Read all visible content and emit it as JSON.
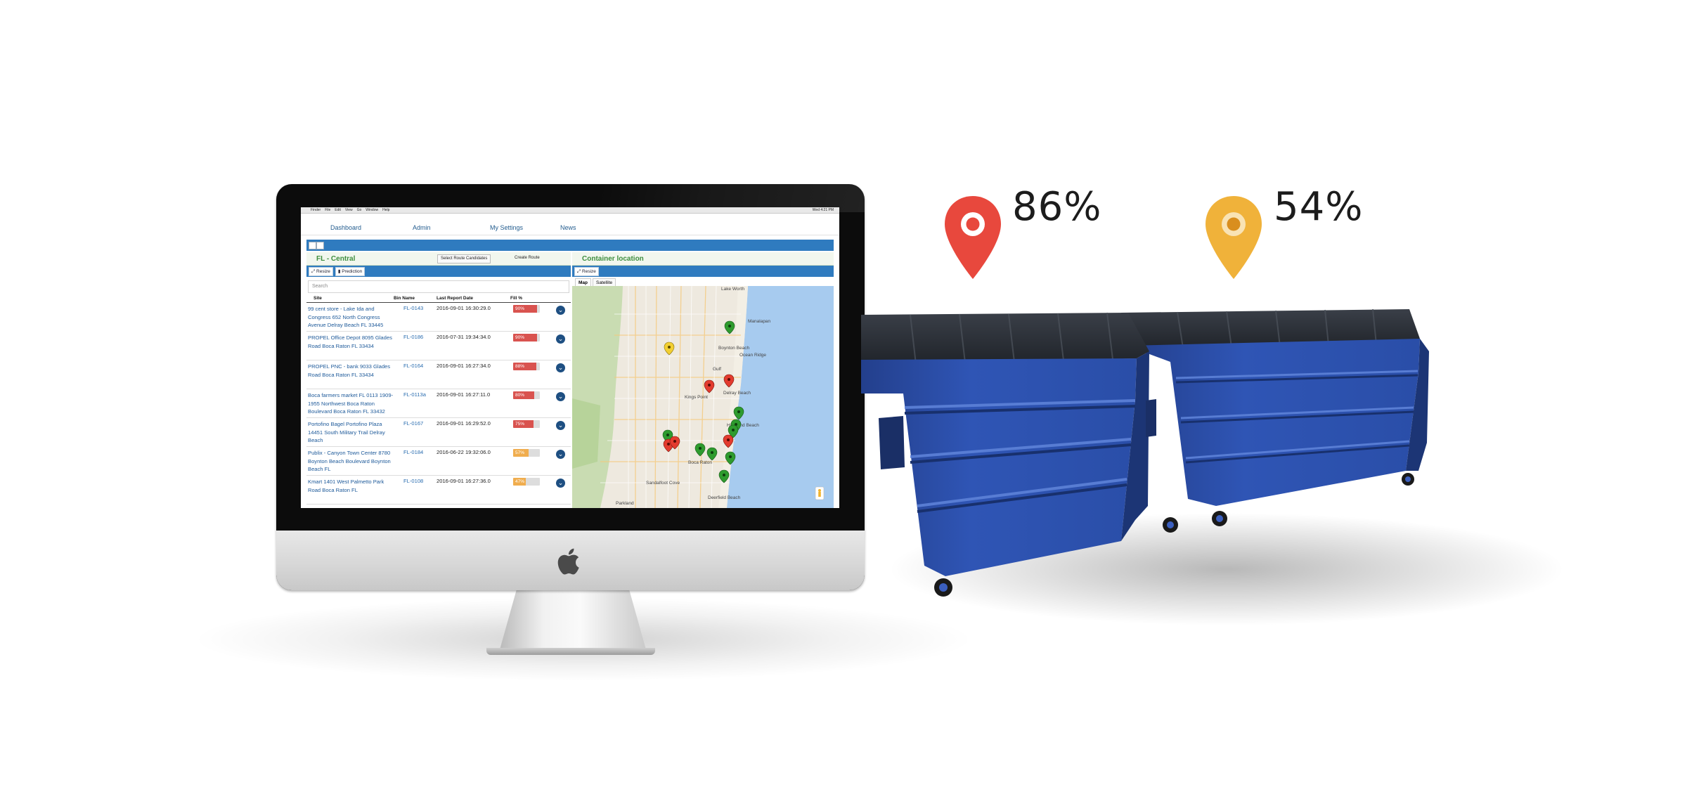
{
  "menubar": {
    "items": [
      "Finder",
      "File",
      "Edit",
      "View",
      "Go",
      "Window",
      "Help"
    ],
    "clock": "Wed 4:21 PM"
  },
  "nav": {
    "items": [
      {
        "label": "Dashboard",
        "icon": "dashboard-icon"
      },
      {
        "label": "Admin",
        "icon": "wrench-icon"
      },
      {
        "label": "My Settings",
        "icon": "gears-icon"
      },
      {
        "label": "News",
        "icon": "bullhorn-icon"
      }
    ]
  },
  "left_panel": {
    "title": "FL - Central",
    "select_route_label": "Select Route Candidates",
    "create_route_label": "Create Route",
    "buttons": [
      "Resize",
      "Prediction"
    ],
    "search_placeholder": "Search",
    "columns": [
      "Site",
      "Bin Name",
      "Last Report Date",
      "Fill %"
    ],
    "rows": [
      {
        "site": "99 cent store - Lake Ida and Congress 652 North Congress Avenue Delray Beach FL 33445",
        "bin": "FL-0143",
        "date": "2016-09-01 16:30:29.0",
        "fill": "90%",
        "fill_value": 90,
        "color": "#d9534f"
      },
      {
        "site": "PROPEL Office Depot 8095 Glades Road Boca Raton FL 33434",
        "bin": "FL-0186",
        "date": "2016-07-31 19:34:34.0",
        "fill": "90%",
        "fill_value": 90,
        "color": "#d9534f"
      },
      {
        "site": "PROPEL PNC - bank 9033 Glades Road Boca Raton FL 33434",
        "bin": "FL-0164",
        "date": "2016-09-01 16:27:34.0",
        "fill": "88%",
        "fill_value": 88,
        "color": "#d9534f"
      },
      {
        "site": "Boca farmers market FL 0113 1909-1955 Northwest Boca Raton Boulevard Boca Raton FL 33432",
        "bin": "FL-0113a",
        "date": "2016-09-01 16:27:11.0",
        "fill": "80%",
        "fill_value": 80,
        "color": "#d9534f"
      },
      {
        "site": "Portofino Bagel Portofino Plaza 14451 South Military Trail Delray Beach",
        "bin": "FL-0167",
        "date": "2016-09-01 16:29:52.0",
        "fill": "75%",
        "fill_value": 75,
        "color": "#d9534f"
      },
      {
        "site": "Publix - Canyon Town Center 8780 Boynton Beach Boulevard Boynton Beach FL",
        "bin": "FL-0184",
        "date": "2016-06-22 19:32:06.0",
        "fill": "57%",
        "fill_value": 57,
        "color": "#f0ad4e"
      },
      {
        "site": "Kmart 1401 West Palmetto Park Road Boca Raton FL",
        "bin": "FL-0108",
        "date": "2016-09-01 16:27:36.0",
        "fill": "47%",
        "fill_value": 47,
        "color": "#f0ad4e"
      }
    ]
  },
  "right_panel": {
    "title": "Container location",
    "resize_label": "Resize",
    "map_tabs": [
      "Map",
      "Satellite"
    ],
    "map_labels": [
      "Lake Worth",
      "Manalapan",
      "Boynton Beach",
      "Ocean Ridge",
      "Gulf",
      "Kings Point",
      "Delray Beach",
      "Highland Beach",
      "Boca Raton",
      "Sandalfoot Cove",
      "Deerfield Beach",
      "Parkland"
    ]
  },
  "pins": [
    {
      "percent": "86%",
      "color": "#e8483d",
      "icon": "map-pin-icon"
    },
    {
      "percent": "54%",
      "color": "#f0b23a",
      "icon": "map-pin-icon"
    }
  ],
  "colors": {
    "brand_blue": "#2f7bbf",
    "dumpster_blue": "#2a4ea8",
    "green_header": "#3e8e3e"
  }
}
